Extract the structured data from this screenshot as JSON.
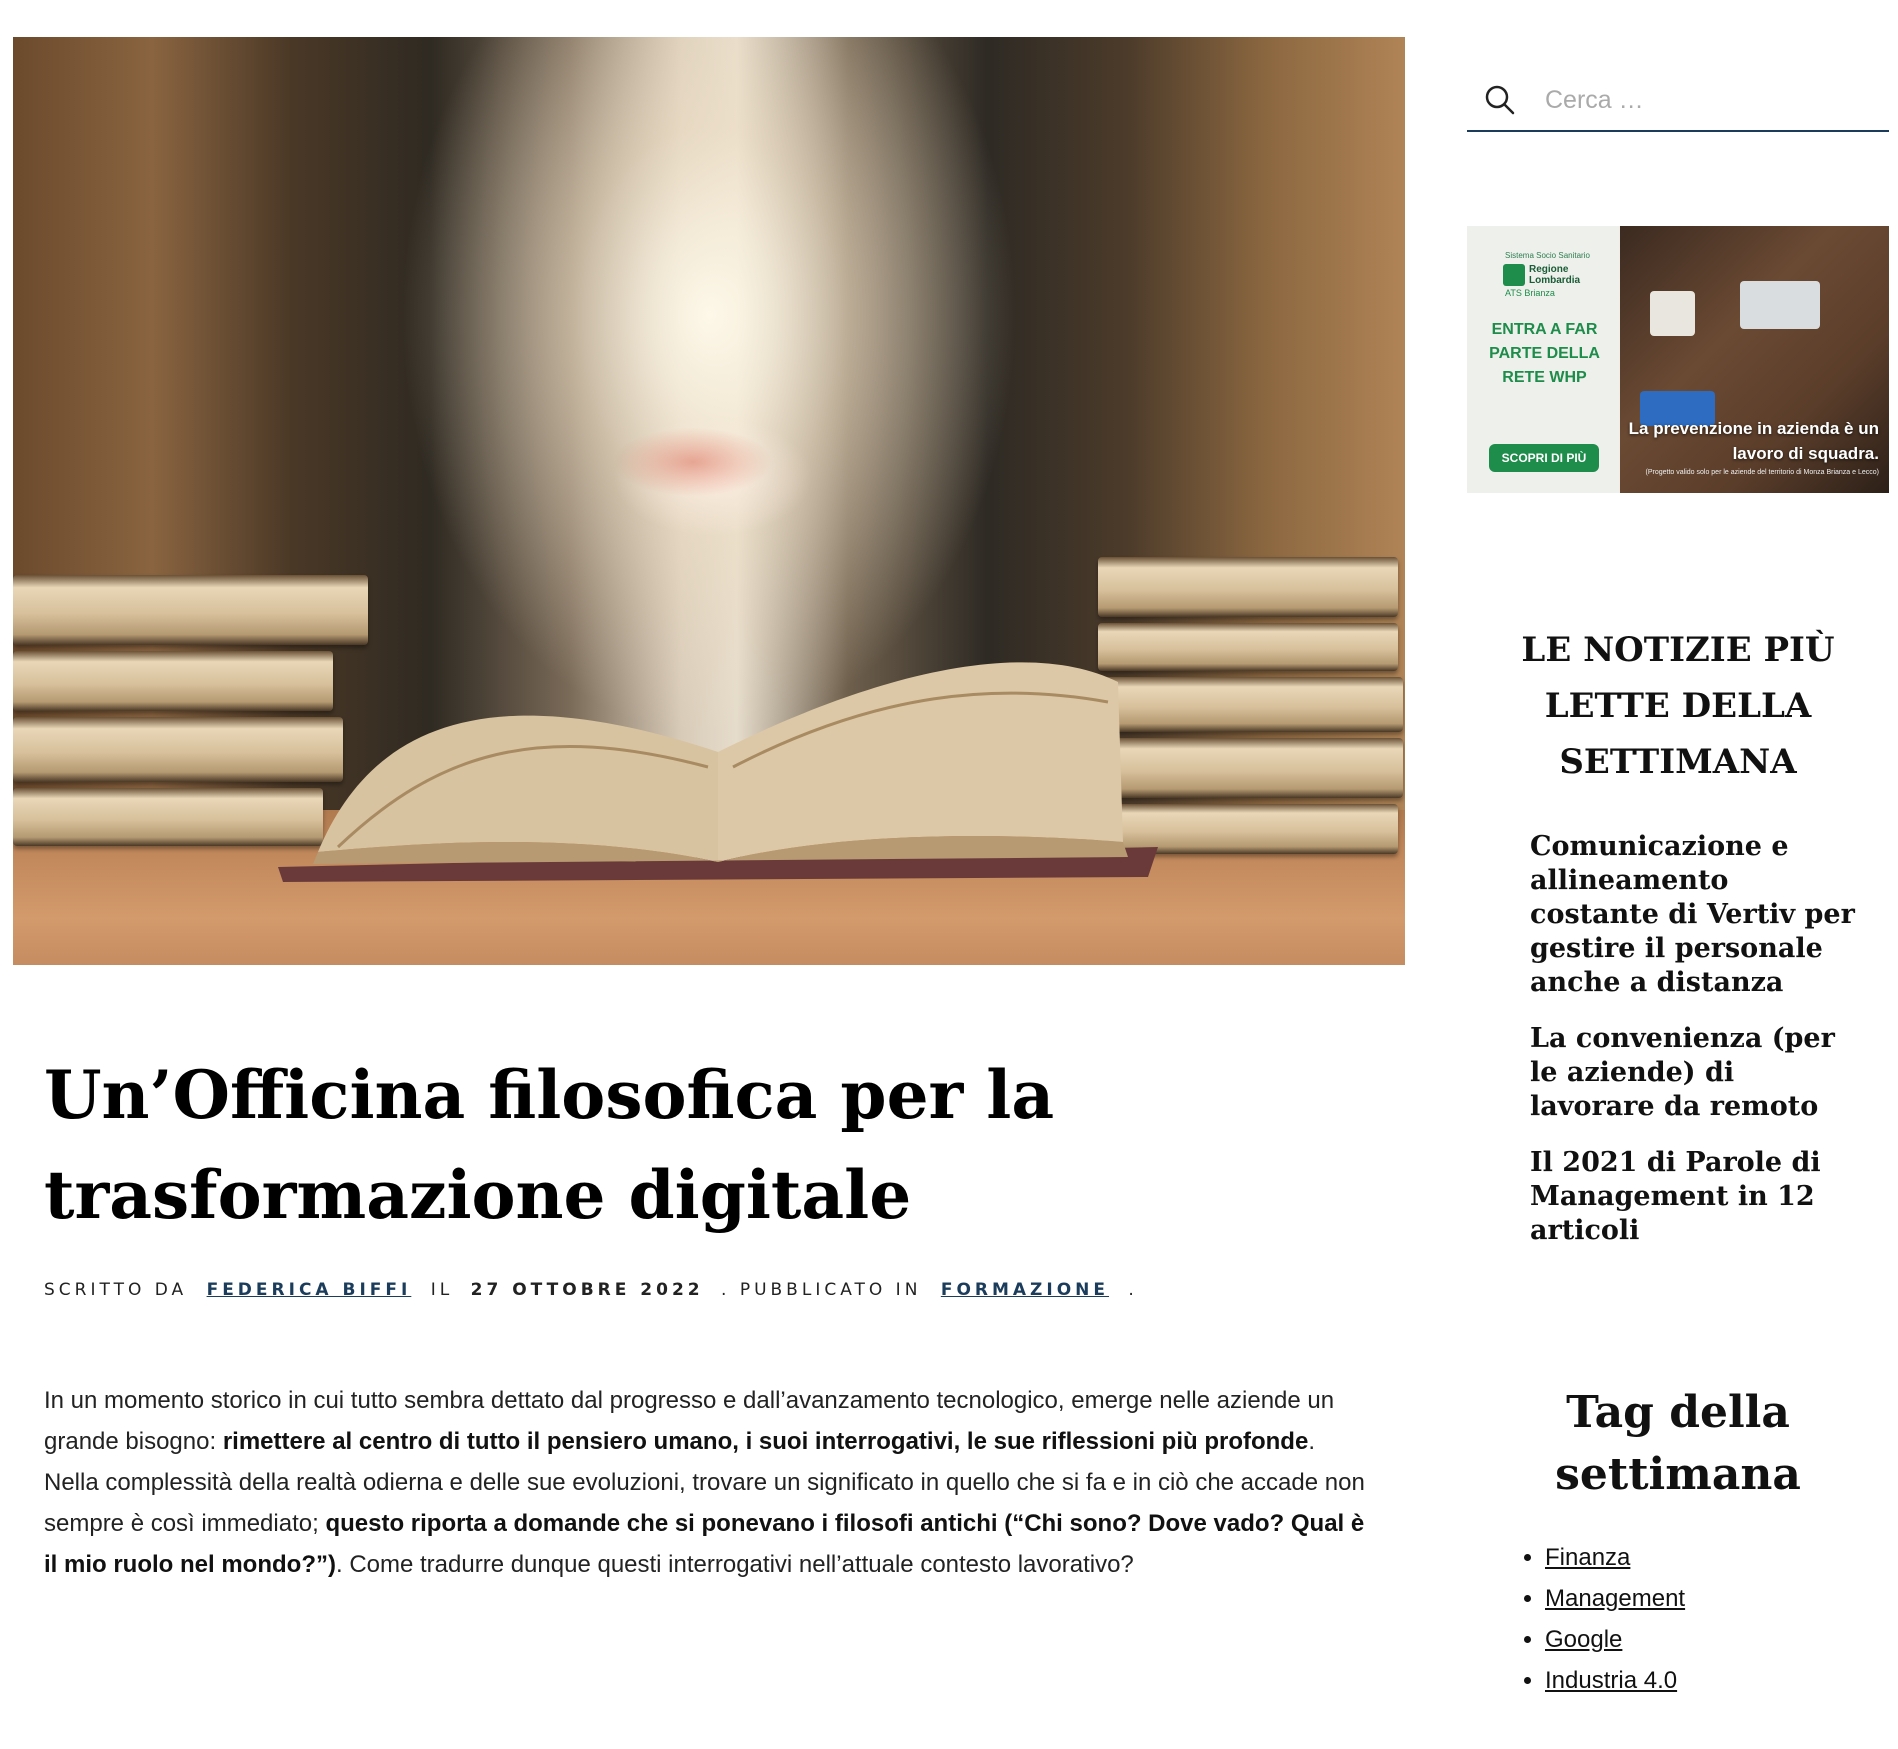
{
  "post": {
    "title": "Un’Officina filosofica per la trasformazione digitale",
    "meta": {
      "written_by_label": "SCRITTO DA",
      "author": "FEDERICA BIFFI",
      "on_label": "IL",
      "date": "27 OTTOBRE 2022",
      "published_label": ". PUBBLICATO IN",
      "category": "FORMAZIONE",
      "end": "."
    },
    "body": {
      "p1_a": "In un momento storico in cui tutto sembra dettato dal progresso e dall’avanzamento tecnologico, emerge nelle aziende un grande bisogno: ",
      "p1_b": "rimettere al centro di tutto il pensiero umano, i suoi interrogativi, le sue riflessioni più profonde",
      "p1_c": ". Nella complessità della realtà odierna e delle sue evoluzioni, trovare un significato in quello che si fa e in ciò che accade non sempre è così immediato; ",
      "p1_d": "questo riporta a domande che si ponevano i filosofi antichi (“Chi sono? Dove vado? Qual è il mio ruolo nel mondo?”)",
      "p1_e": ". Come tradurre dunque questi interrogativi nell’attuale contesto lavorativo?"
    }
  },
  "sidebar": {
    "search": {
      "placeholder": "Cerca …"
    },
    "ad": {
      "small_top": "Sistema Socio Sanitario",
      "logo_text": "Regione Lombardia",
      "sub": "ATS Brianza",
      "cta": "ENTRA A FAR PARTE DELLA RETE WHP",
      "button": "SCOPRI DI PIÙ",
      "caption": "La prevenzione in azienda è un lavoro di squadra.",
      "fine_print": "(Progetto valido solo per le aziende del territorio di Monza Brianza e Lecco)"
    },
    "popular": {
      "title": "LE NOTIZIE PIÙ LETTE DELLA SETTIMANA",
      "items": [
        "Comunicazione e allineamento costante di Vertiv per gestire il personale anche a distanza",
        "La convenienza (per le aziende) di lavorare da remoto",
        "Il 2021 di Parole di Management in 12 articoli"
      ]
    },
    "tags": {
      "title": "Tag della settimana",
      "items": [
        "Finanza",
        "Management",
        "Google",
        "Industria 4.0"
      ]
    }
  },
  "colors": {
    "accent": "#1b3d5b",
    "ad_green": "#1e8c4a"
  }
}
